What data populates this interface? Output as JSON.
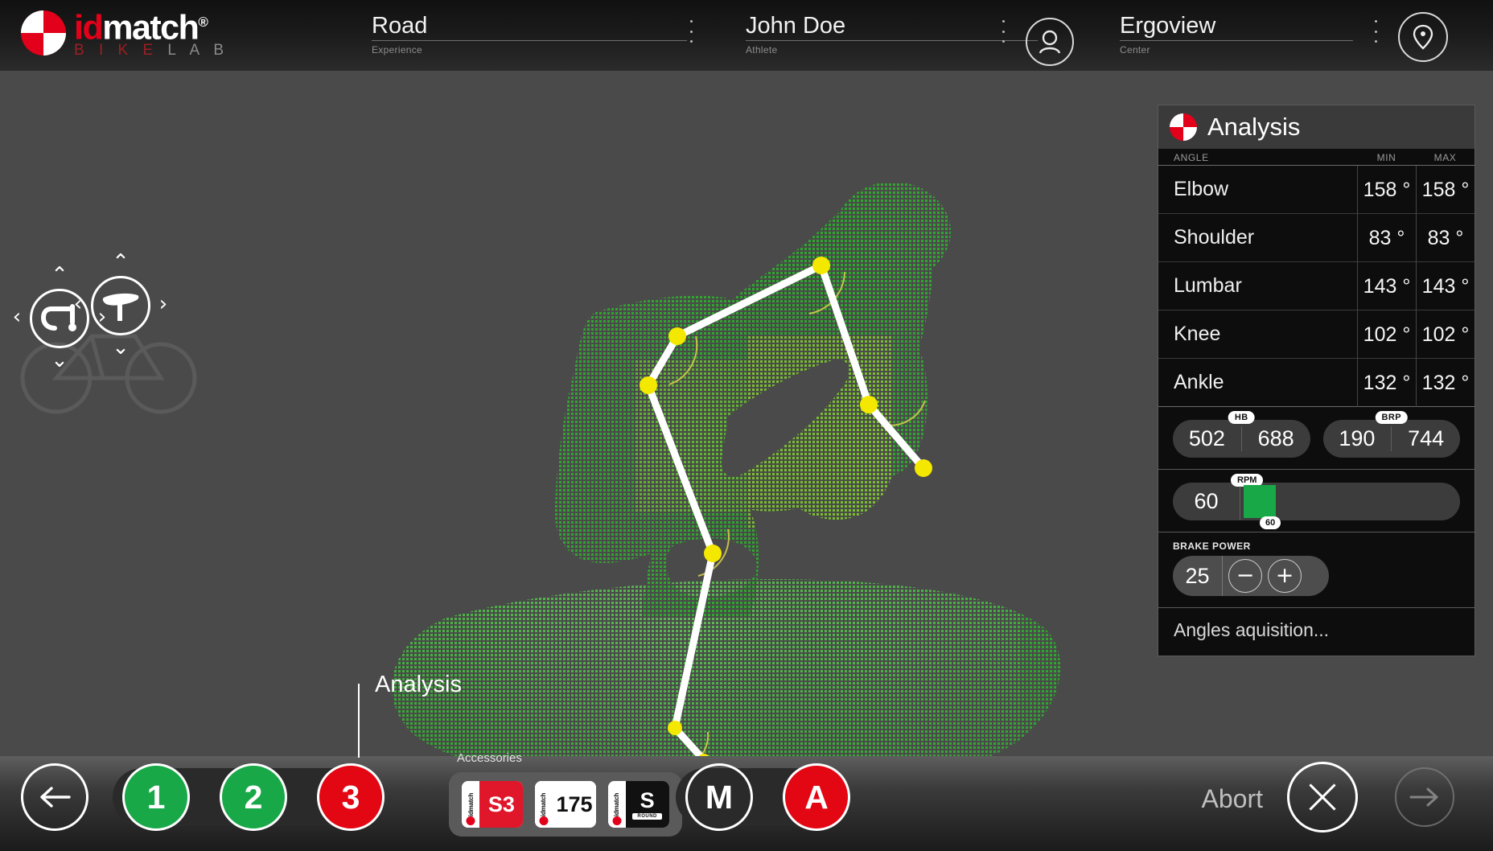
{
  "brand": {
    "name_id": "id",
    "name_match": "match",
    "registered": "®",
    "sub_bike": "B I K E",
    "sub_lab": "L A B",
    "logo_icon": "idmatch-roundel-logo"
  },
  "header": {
    "fields": [
      {
        "value": "Road",
        "label": "Experience",
        "name": "experience-field"
      },
      {
        "value": "John Doe",
        "label": "Athlete",
        "name": "athlete-field"
      },
      {
        "value": "Ergoview",
        "label": "Center",
        "name": "center-field"
      }
    ],
    "menu_icon": "kebab-menu-icon",
    "athlete_icon": "person-avatar-icon",
    "center_icon": "location-pin-icon"
  },
  "stage": {
    "handlebar_control": {
      "icon": "handlebar-icon",
      "up": "⌃",
      "down": "⌄",
      "left": "‹",
      "right": "›"
    },
    "saddle_control": {
      "icon": "saddle-icon",
      "up": "⌃",
      "down": "⌄",
      "left": "‹",
      "right": "›"
    },
    "ghost_icon": "bicycle-silhouette-icon",
    "pointcloud_icon": "rider-point-cloud",
    "skeleton_icon": "joint-skeleton-overlay"
  },
  "panel": {
    "title": "Analysis",
    "logo_icon": "idmatch-roundel-logo",
    "columns": {
      "angle": "ANGLE",
      "min": "MIN",
      "max": "MAX"
    },
    "rows": [
      {
        "name": "Elbow",
        "min": "158 °",
        "max": "158 °"
      },
      {
        "name": "Shoulder",
        "min": "83 °",
        "max": "83 °"
      },
      {
        "name": "Lumbar",
        "min": "143 °",
        "max": "143 °"
      },
      {
        "name": "Knee",
        "min": "102 °",
        "max": "102 °"
      },
      {
        "name": "Ankle",
        "min": "132 °",
        "max": "132 °"
      }
    ],
    "hb": {
      "tag": "HB",
      "left": "502",
      "right": "688"
    },
    "brp": {
      "tag": "BRP",
      "left": "190",
      "right": "744"
    },
    "rpm": {
      "tag": "RPM",
      "value": "60",
      "thumb": "60",
      "bar_color": "#18a848"
    },
    "brake": {
      "label": "BRAKE POWER",
      "value": "25",
      "minus": "−",
      "plus": "+",
      "minus_icon": "minus-icon",
      "plus_icon": "plus-icon"
    },
    "status": "Angles aquisition..."
  },
  "bottom": {
    "section_label": "Analysis",
    "back_icon": "arrow-left-icon",
    "back_glyph": "←",
    "steps": [
      {
        "label": "1",
        "state": "done",
        "color": "#18a848"
      },
      {
        "label": "2",
        "state": "done",
        "color": "#18a848"
      },
      {
        "label": "3",
        "state": "current",
        "color": "#e30613"
      }
    ],
    "accessories": {
      "label": "Accessories",
      "items": [
        {
          "spine": "idmatch",
          "main": "S3",
          "sub": "",
          "bg": "#e0162b",
          "fg": "#ffffff"
        },
        {
          "spine": "idmatch",
          "main": "175",
          "sub": "",
          "bg": "#ffffff",
          "fg": "#111111"
        },
        {
          "spine": "idmatch",
          "main": "S",
          "sub": "ROUND",
          "bg": "#111111",
          "fg": "#ffffff"
        }
      ]
    },
    "modes": [
      {
        "label": "M",
        "active": false,
        "color": "transparent"
      },
      {
        "label": "A",
        "active": true,
        "color": "#e30613"
      }
    ],
    "abort_label": "Abort",
    "abort_icon": "close-x-icon",
    "next_icon": "arrow-right-icon",
    "next_glyph": "→"
  },
  "colors": {
    "brand_red": "#e2001a",
    "accent_green": "#18a848",
    "stage_bg": "#4a4a4a",
    "panel_bg": "#0d0d0d",
    "joint_yellow": "#f5e800",
    "cloud_green": "#2fa62f"
  }
}
